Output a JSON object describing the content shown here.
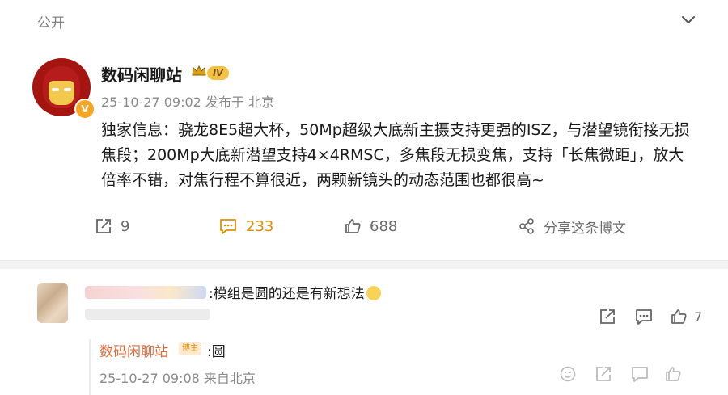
{
  "post": {
    "visibility": "公开",
    "author": "数码闲聊站",
    "level_badge": "IV",
    "verified_mark": "V",
    "meta": "25-10-27 09:02 发布于 北京",
    "text": "独家信息：骁龙8E5超大杯，50Mp超级大底新主摄支持更强的ISZ，与潜望镜衔接无损焦段；200Mp大底新潜望支持4×4RMSC，多焦段无损变焦，支持「长焦微距」，放大倍率不错，对焦行程不算很近，两颗新镜头的动态范围也都很高~",
    "actions": {
      "repost_count": "9",
      "comment_count": "233",
      "like_count": "688",
      "share_label": "分享这条博文"
    }
  },
  "comment": {
    "text": ":模组是圆的还是有新想法",
    "like_count": "7"
  },
  "reply": {
    "author": "数码闲聊站",
    "badge": "博主",
    "text": ":圆",
    "meta": "25-10-27 09:08 来自北京"
  },
  "colors": {
    "accent_orange": "#e08e00",
    "reply_name": "#e06b3a",
    "muted_text": "#8a8a8a"
  },
  "icons": [
    "chevron-down-icon",
    "crown-icon",
    "repost-icon",
    "comment-icon",
    "like-icon",
    "share-icon",
    "emoji-icon"
  ]
}
